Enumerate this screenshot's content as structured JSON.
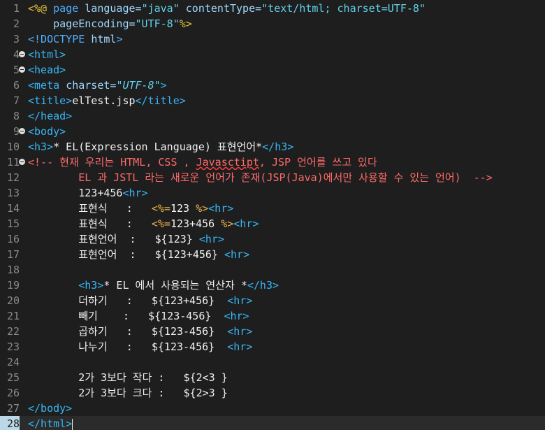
{
  "editor": {
    "lines": [
      {
        "n": "1",
        "fold": false,
        "segs": [
          {
            "t": "<%@ ",
            "c": "dir"
          },
          {
            "t": "page ",
            "c": "kw"
          },
          {
            "t": "language=",
            "c": "attr"
          },
          {
            "t": "\"java\"",
            "c": "str"
          },
          {
            "t": " ",
            "c": "text"
          },
          {
            "t": "contentType=",
            "c": "attr"
          },
          {
            "t": "\"text/html; charset=UTF-8\"",
            "c": "str"
          }
        ]
      },
      {
        "n": "2",
        "fold": false,
        "segs": [
          {
            "t": "    ",
            "c": "text"
          },
          {
            "t": "pageEncoding=",
            "c": "attr"
          },
          {
            "t": "\"UTF-8\"",
            "c": "str"
          },
          {
            "t": "%>",
            "c": "dir"
          }
        ]
      },
      {
        "n": "3",
        "fold": false,
        "segs": [
          {
            "t": "<!DOCTYPE ",
            "c": "kw"
          },
          {
            "t": "html",
            "c": "attr"
          },
          {
            "t": ">",
            "c": "kw"
          }
        ]
      },
      {
        "n": "4",
        "fold": true,
        "segs": [
          {
            "t": "<html>",
            "c": "tag"
          }
        ]
      },
      {
        "n": "5",
        "fold": true,
        "segs": [
          {
            "t": "<head>",
            "c": "tag"
          }
        ]
      },
      {
        "n": "6",
        "fold": false,
        "segs": [
          {
            "t": "<meta ",
            "c": "tag"
          },
          {
            "t": "charset=",
            "c": "attr"
          },
          {
            "t": "\"UTF-8\"",
            "c": "it"
          },
          {
            "t": ">",
            "c": "tag"
          }
        ]
      },
      {
        "n": "7",
        "fold": false,
        "segs": [
          {
            "t": "<title>",
            "c": "tag"
          },
          {
            "t": "elTest.jsp",
            "c": "text"
          },
          {
            "t": "</title>",
            "c": "tag"
          }
        ]
      },
      {
        "n": "8",
        "fold": false,
        "segs": [
          {
            "t": "</head>",
            "c": "tag"
          }
        ]
      },
      {
        "n": "9",
        "fold": true,
        "segs": [
          {
            "t": "<body>",
            "c": "tag"
          }
        ]
      },
      {
        "n": "10",
        "fold": false,
        "segs": [
          {
            "t": "<h3>",
            "c": "tag"
          },
          {
            "t": "* EL(Expression Language) 표현언어*",
            "c": "text"
          },
          {
            "t": "</h3>",
            "c": "tag"
          }
        ]
      },
      {
        "n": "11",
        "fold": true,
        "segs": [
          {
            "t": "<!-- 현재 우리는 HTML, CSS , ",
            "c": "cmt"
          },
          {
            "t": "Javasctipt",
            "c": "squig"
          },
          {
            "t": ", JSP 언어를 쓰고 있다",
            "c": "cmt"
          }
        ]
      },
      {
        "n": "12",
        "fold": false,
        "segs": [
          {
            "t": "        EL 과 JSTL 라는 새로운 언어가 존재(JSP(Java)에서만 사용할 수 있는 언어)  -->",
            "c": "cmt"
          }
        ]
      },
      {
        "n": "13",
        "fold": false,
        "segs": [
          {
            "t": "        123+456",
            "c": "text"
          },
          {
            "t": "<hr>",
            "c": "tag"
          }
        ]
      },
      {
        "n": "14",
        "fold": false,
        "segs": [
          {
            "t": "        표현식   :   ",
            "c": "text"
          },
          {
            "t": "<%=",
            "c": "el"
          },
          {
            "t": "123 ",
            "c": "num"
          },
          {
            "t": "%>",
            "c": "el"
          },
          {
            "t": "<hr>",
            "c": "tag"
          }
        ]
      },
      {
        "n": "15",
        "fold": false,
        "segs": [
          {
            "t": "        표현식   :   ",
            "c": "text"
          },
          {
            "t": "<%=",
            "c": "el"
          },
          {
            "t": "123+456 ",
            "c": "num"
          },
          {
            "t": "%>",
            "c": "el"
          },
          {
            "t": "<hr>",
            "c": "tag"
          }
        ]
      },
      {
        "n": "16",
        "fold": false,
        "segs": [
          {
            "t": "        표현언어  :   ${123} ",
            "c": "text"
          },
          {
            "t": "<hr>",
            "c": "tag"
          }
        ]
      },
      {
        "n": "17",
        "fold": false,
        "segs": [
          {
            "t": "        표현언어  :   ${123+456} ",
            "c": "text"
          },
          {
            "t": "<hr>",
            "c": "tag"
          }
        ]
      },
      {
        "n": "18",
        "fold": false,
        "segs": [
          {
            "t": "",
            "c": "text"
          }
        ]
      },
      {
        "n": "19",
        "fold": false,
        "segs": [
          {
            "t": "        ",
            "c": "text"
          },
          {
            "t": "<h3>",
            "c": "tag"
          },
          {
            "t": "* EL 에서 사용되는 연산자 *",
            "c": "text"
          },
          {
            "t": "</h3>",
            "c": "tag"
          }
        ]
      },
      {
        "n": "20",
        "fold": false,
        "segs": [
          {
            "t": "        더하기   :   ${123+456}  ",
            "c": "text"
          },
          {
            "t": "<hr>",
            "c": "tag"
          }
        ]
      },
      {
        "n": "21",
        "fold": false,
        "segs": [
          {
            "t": "        빼기    :   ${123-456}  ",
            "c": "text"
          },
          {
            "t": "<hr>",
            "c": "tag"
          }
        ]
      },
      {
        "n": "22",
        "fold": false,
        "segs": [
          {
            "t": "        곱하기   :   ${123-456}  ",
            "c": "text"
          },
          {
            "t": "<hr>",
            "c": "tag"
          }
        ]
      },
      {
        "n": "23",
        "fold": false,
        "segs": [
          {
            "t": "        나누기   :   ${123-456}  ",
            "c": "text"
          },
          {
            "t": "<hr>",
            "c": "tag"
          }
        ]
      },
      {
        "n": "24",
        "fold": false,
        "segs": [
          {
            "t": "",
            "c": "text"
          }
        ]
      },
      {
        "n": "25",
        "fold": false,
        "segs": [
          {
            "t": "        2가 3보다 작다 :   ${2<3 }",
            "c": "text"
          }
        ]
      },
      {
        "n": "26",
        "fold": false,
        "segs": [
          {
            "t": "        2가 3보다 크다 :   ${2>3 }",
            "c": "text"
          }
        ]
      },
      {
        "n": "27",
        "fold": false,
        "segs": [
          {
            "t": "</body>",
            "c": "tag"
          }
        ]
      },
      {
        "n": "28",
        "fold": false,
        "active": true,
        "segs": [
          {
            "t": "</html>",
            "c": "tag"
          }
        ]
      }
    ]
  }
}
